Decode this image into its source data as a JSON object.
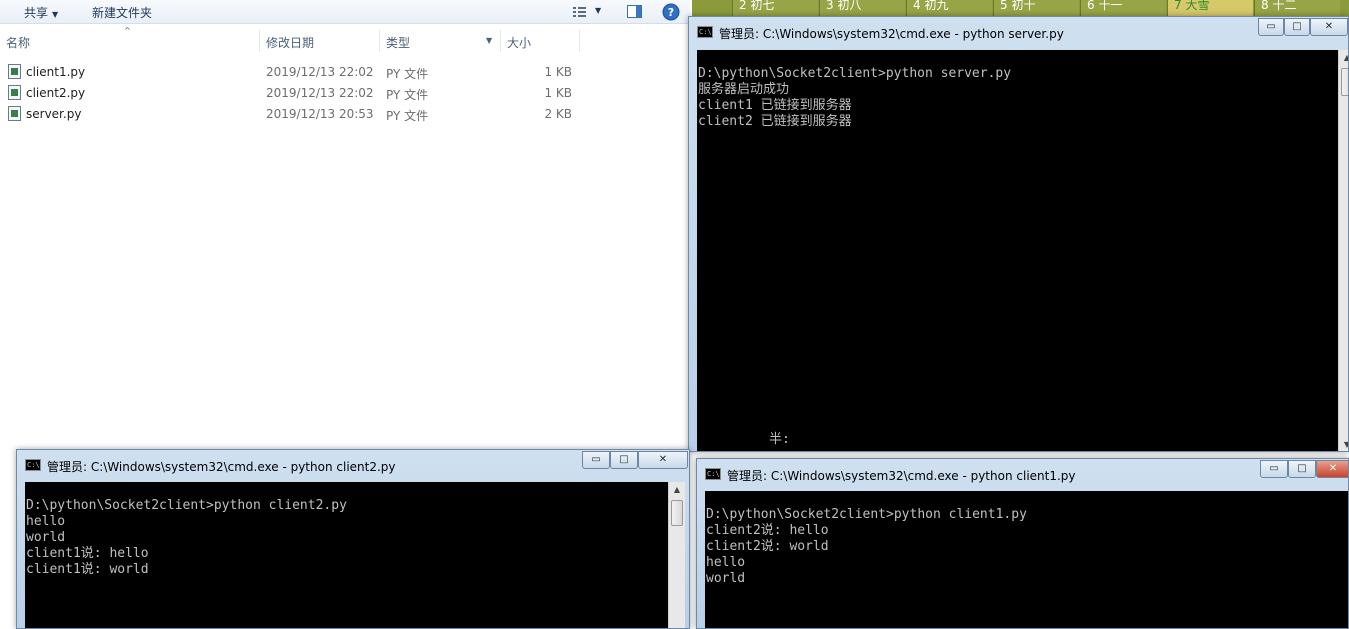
{
  "explorer": {
    "toolbar": {
      "share": "共享",
      "new_folder": "新建文件夹"
    },
    "columns": {
      "name": "名称",
      "date": "修改日期",
      "type": "类型",
      "size": "大小"
    },
    "files": [
      {
        "name": "client1.py",
        "date": "2019/12/13 22:02",
        "type": "PY 文件",
        "size": "1 KB"
      },
      {
        "name": "client2.py",
        "date": "2019/12/13 22:02",
        "type": "PY 文件",
        "size": "1 KB"
      },
      {
        "name": "server.py",
        "date": "2019/12/13 20:53",
        "type": "PY 文件",
        "size": "2 KB"
      }
    ]
  },
  "calendar": {
    "cells": [
      "2 初七",
      "3 初八",
      "4 初九",
      "5 初十",
      "6 十一",
      "7 大雪",
      "8 十二"
    ],
    "highlight_color": "#2e8b2e"
  },
  "windows": {
    "server": {
      "title": "管理员: C:\\Windows\\system32\\cmd.exe - python  server.py",
      "lines": [
        "D:\\python\\Socket2client>python server.py",
        "服务器启动成功",
        "client1 已链接到服务器",
        "client2 已链接到服务器"
      ],
      "ime_text": "半:"
    },
    "client2": {
      "title": "管理员: C:\\Windows\\system32\\cmd.exe - python  client2.py",
      "lines": [
        "D:\\python\\Socket2client>python client2.py",
        "hello",
        "world",
        "client1说: hello",
        "client1说: world"
      ]
    },
    "client1": {
      "title": "管理员: C:\\Windows\\system32\\cmd.exe - python  client1.py",
      "lines": [
        "D:\\python\\Socket2client>python client1.py",
        "client2说: hello",
        "client2说: world",
        "hello",
        "world"
      ]
    }
  },
  "icons": {
    "cmd": "C:\\",
    "minimize": "▭",
    "maximize": "□",
    "close": "✕"
  },
  "colors": {
    "console_bg": "#000000",
    "console_fg": "#c0c0c0",
    "title_bar": "#b9cfe6",
    "close_button": "#c6452e"
  }
}
